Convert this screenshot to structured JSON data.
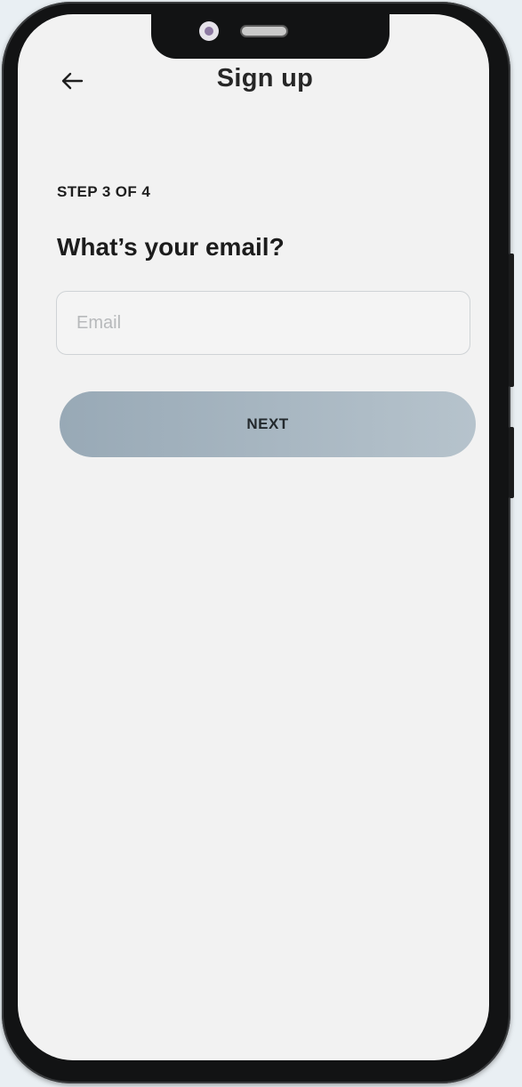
{
  "header": {
    "title": "Sign up",
    "back_icon": "arrow-left-icon"
  },
  "content": {
    "step_label": "STEP 3 OF 4",
    "question": "What’s your email?",
    "email": {
      "value": "",
      "placeholder": "Email"
    },
    "next_label": "NEXT"
  },
  "colors": {
    "screen_background": "#f2f2f2",
    "button_gradient_start": "#98a9b6",
    "button_gradient_end": "#b6c3cc",
    "text_primary": "#1c1c1c",
    "placeholder": "#b7b9bb"
  }
}
